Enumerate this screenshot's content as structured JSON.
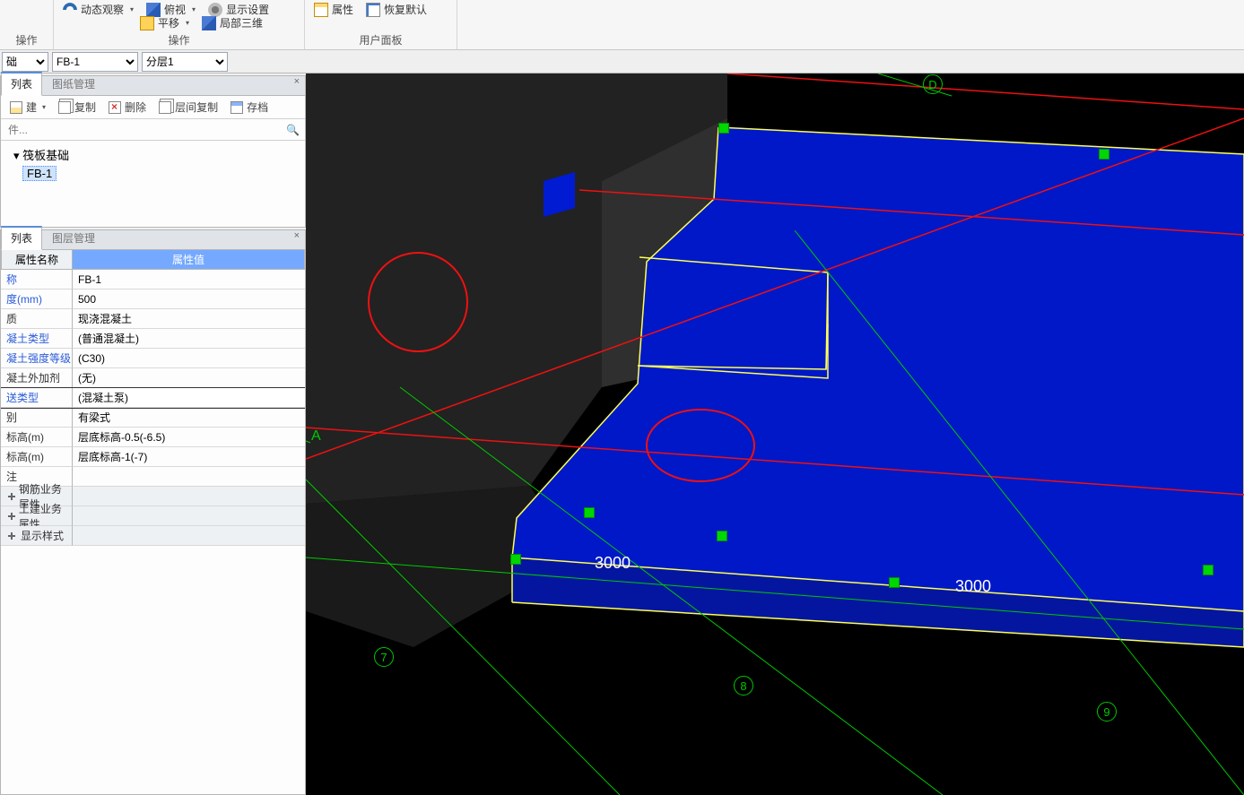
{
  "ribbon": {
    "group1": {
      "items": [
        "动态观察",
        "俯视",
        "显示设置",
        "平移",
        "局部三维"
      ],
      "extraTop": "",
      "title": "操作"
    },
    "group0Title": "操作",
    "group2": {
      "prop": "属性",
      "reset": "恢复默认",
      "title": "用户面板"
    }
  },
  "selects": {
    "s1": "础",
    "s2": "FB-1",
    "s3": "分层1"
  },
  "panelTabs": {
    "list": "列表",
    "drawing": "图纸管理",
    "layer": "图层管理"
  },
  "panelListToolbar": {
    "new": "建",
    "copy": "复制",
    "del": "删除",
    "floorCopy": "层间复制",
    "archive": "存档"
  },
  "searchPlaceholder": "件...",
  "tree": {
    "root": "筏板基础",
    "child": "FB-1"
  },
  "propHeader": {
    "name": "属性名称",
    "value": "属性值"
  },
  "props": [
    {
      "n": "称",
      "v": "FB-1",
      "link": true
    },
    {
      "n": "度(mm)",
      "v": "500",
      "link": true
    },
    {
      "n": "质",
      "v": "现浇混凝土",
      "link": false
    },
    {
      "n": "凝土类型",
      "v": "(普通混凝土)",
      "link": true
    },
    {
      "n": "凝土强度等级",
      "v": "(C30)",
      "link": true
    },
    {
      "n": "凝土外加剂",
      "v": "(无)",
      "link": false
    },
    {
      "n": "送类型",
      "v": "(混凝土泵)",
      "link": true,
      "sel": true
    },
    {
      "n": "别",
      "v": "有梁式",
      "link": false
    },
    {
      "n": "标高(m)",
      "v": "层底标高-0.5(-6.5)",
      "link": false
    },
    {
      "n": "标高(m)",
      "v": "层底标高-1(-7)",
      "link": false
    },
    {
      "n": "注",
      "v": "",
      "link": false
    }
  ],
  "propGroups": [
    "钢筋业务属性",
    "土建业务属性",
    "显示样式"
  ],
  "viewport": {
    "axisA": "A",
    "axisD": "D",
    "axis7": "7",
    "axis8": "8",
    "axis9": "9",
    "dim1": "3000",
    "dim2": "3000"
  }
}
